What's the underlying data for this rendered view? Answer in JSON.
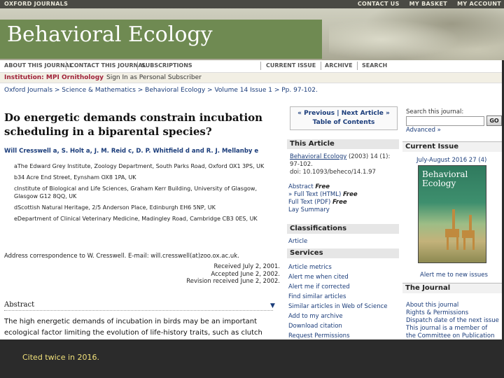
{
  "topbar": {
    "brand": "OXFORD JOURNALS",
    "links": [
      "CONTACT US",
      "MY BASKET",
      "MY ACCOUNT"
    ]
  },
  "banner": {
    "title": "Behavioral Ecology"
  },
  "nav": {
    "items": [
      "ABOUT THIS JOURNAL",
      "CONTACT THIS JOURNAL",
      "SUBSCRIPTIONS",
      "CURRENT ISSUE",
      "ARCHIVE",
      "SEARCH"
    ]
  },
  "institution": {
    "label": "Institution: MPI Ornithology",
    "signin": "Sign In as Personal Subscriber"
  },
  "breadcrumb": "Oxford Journals > Science & Mathematics > Behavioral Ecology > Volume 14 Issue 1 > Pp. 97-102.",
  "article": {
    "title": "Do energetic demands constrain incubation scheduling in a biparental species?",
    "authors": "Will Cresswell a, S. Holt a, J. M. Reid c, D. P. Whitfield d and R. J. Mellanby e",
    "affiliations": [
      "aThe Edward Grey Institute, Zoology Department, South Parks Road, Oxford OX1 3PS, UK",
      "b34 Acre End Street, Eynsham OX8 1PA, UK",
      "cInstitute of Biological and Life Sciences, Graham Kerr Building, University of Glasgow, Glasgow G12 8QQ, UK",
      "dScottish Natural Heritage, 2/5 Anderson Place, Edinburgh EH6 5NP, UK",
      "eDepartment of Clinical Veterinary Medicine, Madingley Road, Cambridge CB3 0ES, UK"
    ],
    "correspondence": "Address correspondence to W. Cresswell. E-mail: will.cresswell(at)zoo.ox.ac.uk.",
    "dates": [
      "Received July 2, 2001.",
      "Accepted June 2, 2002.",
      "Revision received June 2, 2002."
    ],
    "abstract_heading": "Abstract",
    "abstract_text": "The high energetic demands of incubation in birds may be an important ecological factor limiting the evolution of life-history traits, such as clutch"
  },
  "sidebar_mid": {
    "prev_next": "« Previous | Next Article »",
    "toc": "Table of Contents",
    "this_article": "This Article",
    "citation_journal": "Behavioral Ecology",
    "citation_rest": "(2003) 14 (1): 97-102.",
    "doi": "doi: 10.1093/beheco/14.1.97",
    "article_links": [
      {
        "label": "Abstract",
        "tag": "Free"
      },
      {
        "label": "» Full Text (HTML)",
        "tag": "Free"
      },
      {
        "label": "Full Text (PDF)",
        "tag": "Free"
      },
      {
        "label": "Lay Summary",
        "tag": ""
      }
    ],
    "classifications": "Classifications",
    "class_item": "Article",
    "services": "Services",
    "service_links": [
      "Article metrics",
      "Alert me when cited",
      "Alert me if corrected",
      "Find similar articles",
      "Similar articles in Web of Science",
      "Add to my archive",
      "Download citation",
      "Request Permissions"
    ]
  },
  "sidebar_right": {
    "search_label": "Search this journal:",
    "search_value": "",
    "go": "GO",
    "advanced": "Advanced »",
    "current_issue": "Current Issue",
    "issue_date": "July-August 2016 27 (4)",
    "cover_title": "Behavioral Ecology",
    "alert_new": "Alert me to new issues",
    "the_journal": "The Journal",
    "journal_links": [
      "About this journal",
      "Rights & Permissions",
      "Dispatch date of the next issue",
      "This journal is a member of",
      "the Committee on Publication"
    ]
  },
  "footer_caption": "Cited twice in 2016."
}
